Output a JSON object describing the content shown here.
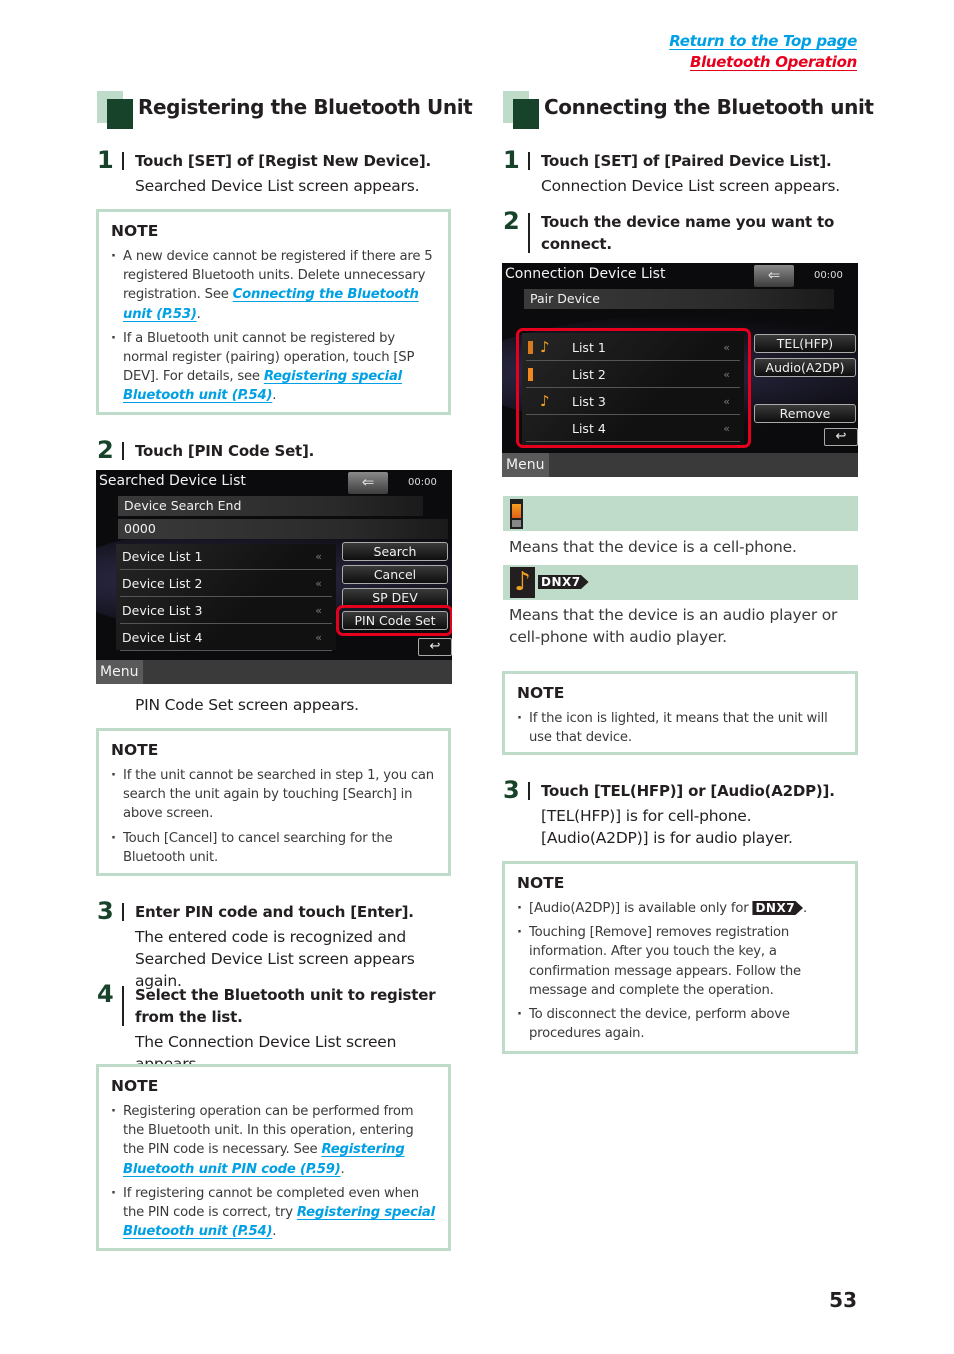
{
  "header": {
    "links": [
      {
        "label": "Return to the Top page",
        "color": "#00a0e4"
      },
      {
        "label": "Bluetooth Operation",
        "color": "#e6001e"
      }
    ]
  },
  "left": {
    "title": "Registering the Bluetooth Unit",
    "steps": [
      {
        "num": "1",
        "head": "Touch [SET] of [Regist New Device].",
        "body": "Searched Device List screen appears."
      },
      {
        "num": "2",
        "head": "Touch [PIN Code Set].",
        "body": "PIN Code Set screen appears."
      },
      {
        "num": "3",
        "head": "Enter PIN code and touch [Enter].",
        "body_lines": [
          "The entered code is recognized and",
          "Searched Device List screen appears again."
        ]
      },
      {
        "num": "4",
        "head_lines": [
          "Select the Bluetooth unit to register",
          "from the list."
        ],
        "body": "The Connection Device List screen appears."
      }
    ],
    "notes": [
      {
        "title": "NOTE",
        "items": [
          {
            "text": "A new device cannot be registered if there are 5 registered Bluetooth units. Delete unnecessary registration. See ",
            "link": "Connecting the Bluetooth unit (P.53)",
            "after": "."
          },
          {
            "text": "If a Bluetooth unit cannot be registered by normal register (pairing) operation, touch [SP DEV]. For details, see ",
            "link": "Registering special Bluetooth unit (P.54)",
            "after": "."
          }
        ]
      },
      {
        "title": "NOTE",
        "items": [
          {
            "text": "If the unit cannot be searched in step 1, you can search the unit again by touching [Search] in above screen."
          },
          {
            "text": "Touch [Cancel] to cancel searching for the Bluetooth unit."
          }
        ]
      },
      {
        "title": "NOTE",
        "items": [
          {
            "text": "Registering operation can be performed from the Bluetooth unit. In this operation, entering the PIN code is necessary. See ",
            "link": "Registering Bluetooth unit PIN code (P.59)",
            "after": "."
          },
          {
            "text": "If registering cannot be completed even when the PIN code is correct, try ",
            "link": "Registering special Bluetooth unit (P.54)",
            "after": "."
          }
        ]
      }
    ],
    "screen": {
      "title": "Searched Device List",
      "back_icon": "⇐",
      "clock": "00:00",
      "status": "Device Search End",
      "pin": "0000",
      "rows": [
        "Device List 1",
        "Device List 2",
        "Device List 3",
        "Device List 4"
      ],
      "row_arrow": "«",
      "buttons": [
        "Search",
        "Cancel",
        "SP DEV",
        "PIN Code Set"
      ],
      "return_icon": "↩",
      "menu": "Menu"
    }
  },
  "right": {
    "title": "Connecting the Bluetooth unit",
    "steps": [
      {
        "num": "1",
        "head": "Touch [SET] of [Paired Device List].",
        "body": "Connection Device List screen appears."
      },
      {
        "num": "2",
        "head_lines": [
          "Touch the device name you want to",
          "connect."
        ]
      },
      {
        "num": "3",
        "head": "Touch [TEL(HFP)] or [Audio(A2DP)].",
        "body_lines": [
          "[TEL(HFP)] is for cell-phone.",
          "[Audio(A2DP)] is for audio player."
        ]
      }
    ],
    "screen": {
      "title": "Connection Device List",
      "back_icon": "⇐",
      "clock": "00:00",
      "status": "Pair Device",
      "rows": [
        {
          "label": "List 1",
          "phone": true,
          "audio": true
        },
        {
          "label": "List 2",
          "phone": true,
          "audio": false
        },
        {
          "label": "List 3",
          "phone": false,
          "audio": true
        },
        {
          "label": "List 4",
          "phone": false,
          "audio": false
        }
      ],
      "row_arrow": "«",
      "buttons": [
        "TEL(HFP)",
        "Audio(A2DP)",
        "Remove"
      ],
      "return_icon": "↩",
      "menu": "Menu"
    },
    "icon_legend": [
      {
        "icon": "cell-phone-icon",
        "desc": "Means that the device is a cell-phone."
      },
      {
        "icon": "audio-note-icon",
        "badge": "DNX7",
        "desc_lines": [
          "Means that the device is an audio player or",
          "cell-phone with audio player."
        ]
      }
    ],
    "notes": [
      {
        "title": "NOTE",
        "items": [
          {
            "text": "If the icon is lighted, it means that the unit will use that device."
          }
        ]
      },
      {
        "title": "NOTE",
        "items": [
          {
            "text": "[Audio(A2DP)] is available only for ",
            "badge": "DNX7",
            "after": "."
          },
          {
            "text": "Touching [Remove] removes registration information. After you touch the key, a confirmation message appears. Follow the message and complete the operation."
          },
          {
            "text": "To disconnect the device, perform above procedures again."
          }
        ]
      }
    ]
  },
  "page_number": "53",
  "colors": {
    "accent_dark_green": "#17432a",
    "accent_light_green": "#bfdccb",
    "link_blue": "#00a0e4",
    "link_red": "#e6001e",
    "highlight_red": "#e6001e"
  }
}
